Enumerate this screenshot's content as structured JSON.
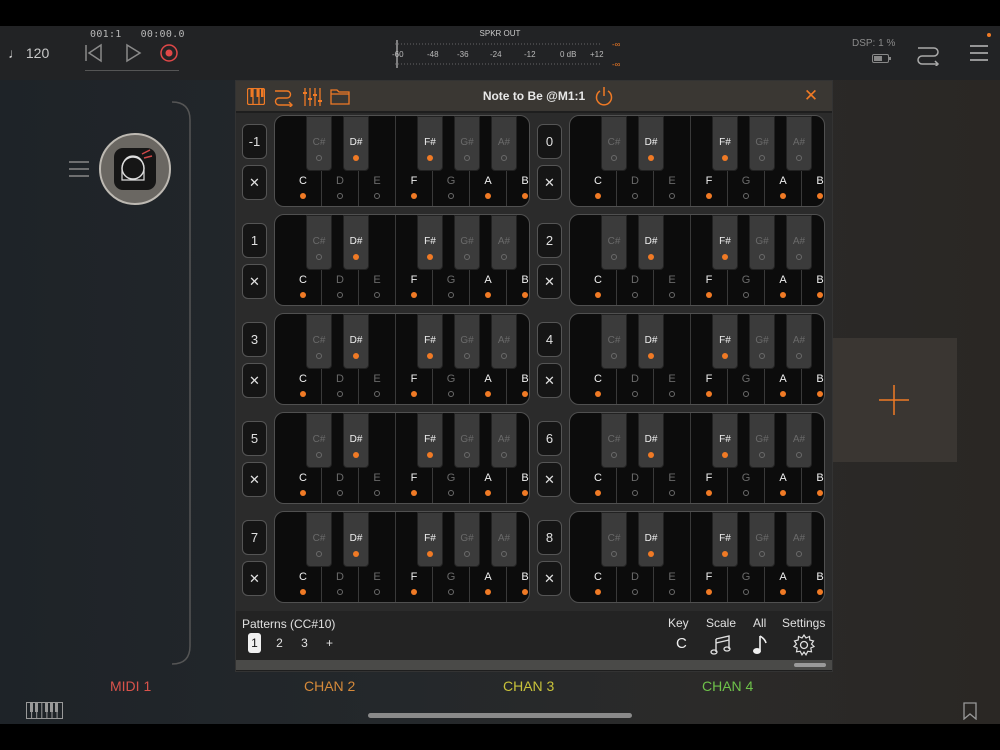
{
  "transport": {
    "tempo": "♩ 120",
    "position": "001:1",
    "time": "00:00.0",
    "meter_label": "SPKR OUT",
    "meter_ticks": [
      "-60",
      "-48",
      "-36",
      "-24",
      "-12",
      "0 dB",
      "+12"
    ],
    "meter_peak": "-∞",
    "dsp": "DSP: 1 %"
  },
  "plugin": {
    "title": "Note to Be @M1:1",
    "close": "✕",
    "patterns_label": "Patterns (CC#10)",
    "patterns": [
      "1",
      "2",
      "3",
      "+"
    ],
    "key_label": "Key",
    "key_value": "C",
    "scale_label": "Scale",
    "all_label": "All",
    "settings_label": "Settings"
  },
  "keys": {
    "white": [
      "C",
      "D",
      "E",
      "F",
      "G",
      "A",
      "B"
    ],
    "black": [
      "C#",
      "D#",
      "F#",
      "G#",
      "A#"
    ],
    "white_active": [
      true,
      false,
      false,
      true,
      false,
      true,
      true
    ],
    "black_active": [
      false,
      true,
      true,
      false,
      false
    ],
    "clear": "✕"
  },
  "rows": [
    "-1",
    "0",
    "1",
    "2",
    "3",
    "4",
    "5",
    "6",
    "7",
    "8"
  ],
  "channels": [
    {
      "label": "MIDI 1",
      "color": "#d9534b"
    },
    {
      "label": "CHAN 2",
      "color": "#d68a3a"
    },
    {
      "label": "CHAN 3",
      "color": "#c8c23a"
    },
    {
      "label": "CHAN 4",
      "color": "#6ec24a"
    }
  ],
  "accent": "#f07a25"
}
